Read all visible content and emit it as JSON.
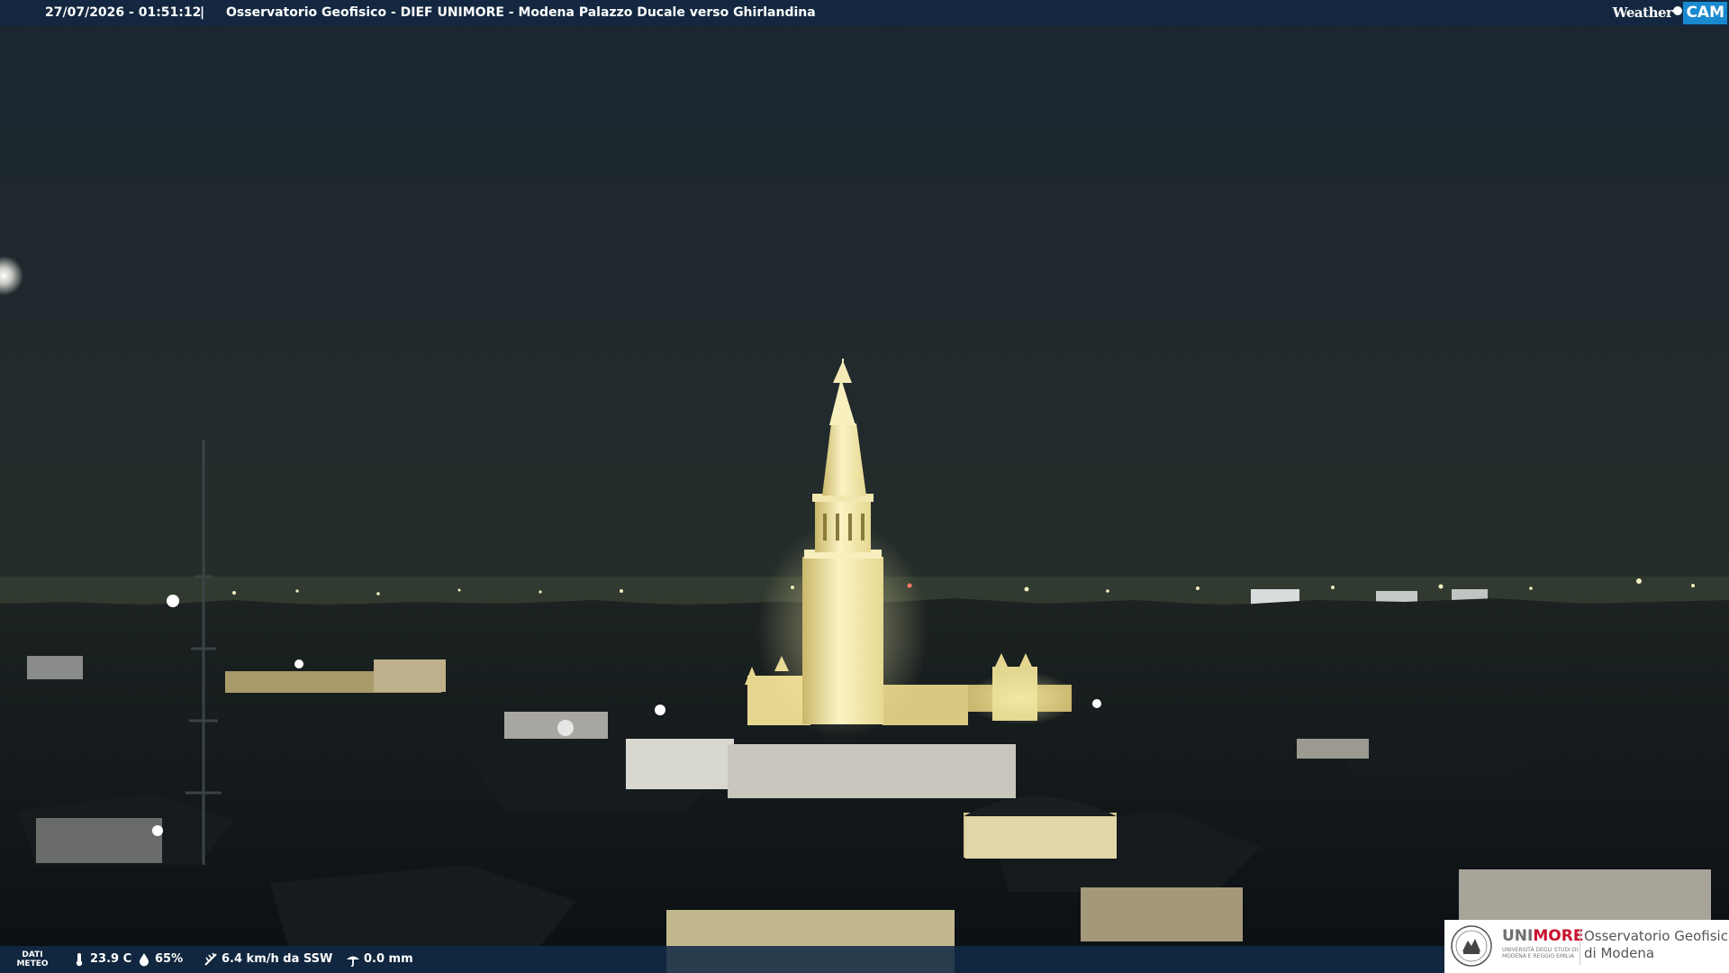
{
  "overlay": {
    "datetime": "27/07/2026 - 01:51:12",
    "separator": "|",
    "camera_title": "Osservatorio Geofisico - DIEF UNIMORE - Modena Palazzo Ducale verso Ghirlandina",
    "brand_weather": "Weather",
    "brand_cam": "CAM"
  },
  "weather": {
    "dati_label_1": "DATI",
    "dati_label_2": "METEO",
    "temperature": "23.9 C",
    "humidity": "65%",
    "wind": "6.4 km/h da SSW",
    "rain": "0.0 mm",
    "icons": [
      "thermometer-icon",
      "humidity-drop-icon",
      "wind-icon",
      "rain-gauge-icon"
    ]
  },
  "logo": {
    "uni_prefix": "UNI",
    "uni_suffix": "MORE",
    "uni_subtitle": "UNIVERSITÀ DEGLI STUDI DI MODENA E REGGIO EMILIA",
    "observatory_line1": "Osservatorio Geofisico",
    "observatory_line2": "di Modena"
  },
  "colors": {
    "bar_blue": "#122842",
    "cam_blue": "#1a8ad0",
    "unimore_red": "#c8102e",
    "tower_light": "#f4ecb0"
  }
}
